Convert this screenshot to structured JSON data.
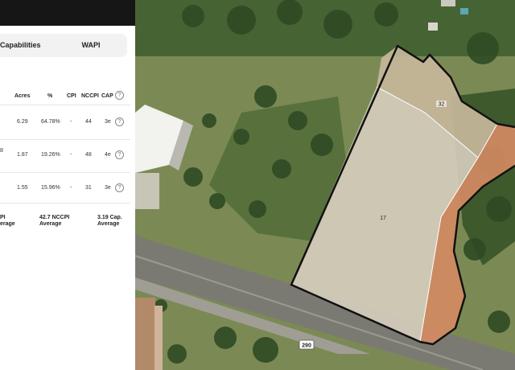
{
  "tabs": {
    "capabilities": "Capabilities",
    "wapi": "WAPI"
  },
  "table": {
    "headers": {
      "acres": "Acres",
      "percent": "%",
      "cpi": "CPI",
      "nccpi": "NCCPI",
      "cap": "CAP",
      "help": "?"
    },
    "rows": [
      {
        "prefix": "",
        "acres": "6.29",
        "percent": "64.78%",
        "cpi": "-",
        "nccpi": "44",
        "cap": "3e",
        "help": "?"
      },
      {
        "prefix": "8",
        "acres": "1.87",
        "percent": "19.26%",
        "cpi": "-",
        "nccpi": "48",
        "cap": "4e",
        "help": "?"
      },
      {
        "prefix": "",
        "acres": "1.55",
        "percent": "15.96%",
        "cpi": "-",
        "nccpi": "31",
        "cap": "3e",
        "help": "?"
      }
    ]
  },
  "averages": {
    "cpi_line1": "PI",
    "cpi_line2": "erage",
    "nccpi_line1": "42.7 NCCPI",
    "nccpi_line2": "Average",
    "cap_line1": "3.19 Cap.",
    "cap_line2": "Average"
  },
  "map": {
    "soil_labels": [
      "32",
      "17"
    ],
    "highway_shield": "290"
  }
}
